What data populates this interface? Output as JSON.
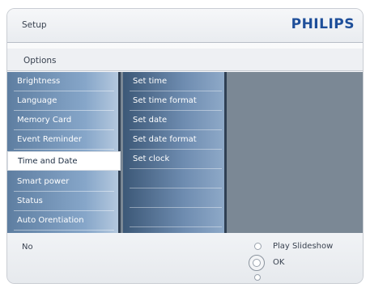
{
  "header": {
    "title": "Setup",
    "brand": "PHILIPS"
  },
  "subheader": {
    "title": "Options"
  },
  "menu_level1": {
    "items": [
      {
        "label": "Brightness"
      },
      {
        "label": "Language"
      },
      {
        "label": "Memory Card"
      },
      {
        "label": "Event Reminder"
      },
      {
        "label": "Time and Date",
        "selected": true
      },
      {
        "label": "Smart power"
      },
      {
        "label": "Status"
      },
      {
        "label": "Auto Orentiation"
      }
    ]
  },
  "menu_level2": {
    "items": [
      {
        "label": "Set time"
      },
      {
        "label": "Set time format"
      },
      {
        "label": "Set date"
      },
      {
        "label": "Set date format"
      },
      {
        "label": "Set clock"
      }
    ]
  },
  "footer": {
    "left_label": "No",
    "hints": {
      "play_label": "Play Slideshow",
      "ok_label": "OK"
    }
  },
  "colors": {
    "brand": "#1f4f9a",
    "menu_l1": "#86a6c9",
    "menu_l2": "#6e8cb0",
    "content_bg": "#7b8895"
  }
}
